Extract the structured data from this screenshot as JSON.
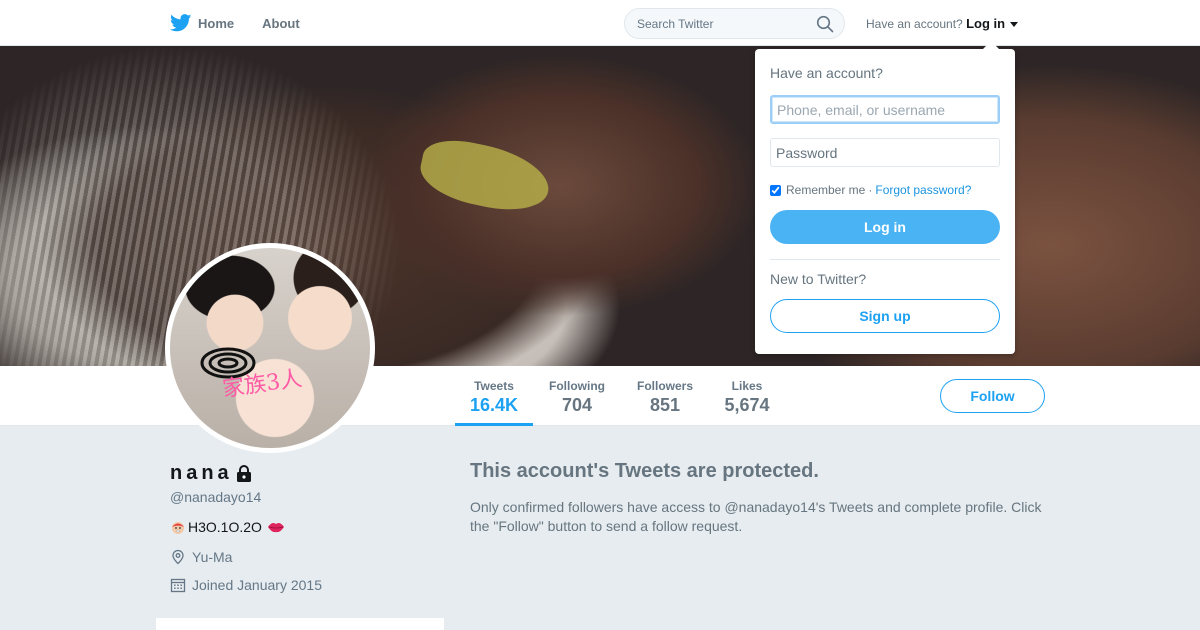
{
  "nav": {
    "home_label": "Home",
    "about_label": "About",
    "search_placeholder": "Search Twitter",
    "account_prompt": "Have an account?",
    "login_label": "Log in"
  },
  "login_dropdown": {
    "title": "Have an account?",
    "username_placeholder": "Phone, email, or username",
    "password_placeholder": "Password",
    "remember_label": "Remember me",
    "separator": "·",
    "forgot_label": "Forgot password?",
    "login_button": "Log in",
    "new_label": "New to Twitter?",
    "signup_button": "Sign up"
  },
  "avatar": {
    "overlay_text": "家族3人"
  },
  "profile_nav": {
    "stats": [
      {
        "label": "Tweets",
        "value": "16.4K"
      },
      {
        "label": "Following",
        "value": "704"
      },
      {
        "label": "Followers",
        "value": "851"
      },
      {
        "label": "Likes",
        "value": "5,674"
      }
    ],
    "follow_button": "Follow"
  },
  "profile": {
    "name": "nana",
    "handle": "@nanadayo14",
    "bio": "H3O.1O.2O",
    "location": "Yu-Ma",
    "joined": "Joined January 2015"
  },
  "protected": {
    "title": "This account's Tweets are protected.",
    "body": "Only confirmed followers have access to @nanadayo14's Tweets and complete profile. Click the \"Follow\" button to send a follow request."
  },
  "colors": {
    "accent": "#1da1f2",
    "login_button": "#4ab3f4",
    "background": "#e6ecf0"
  }
}
